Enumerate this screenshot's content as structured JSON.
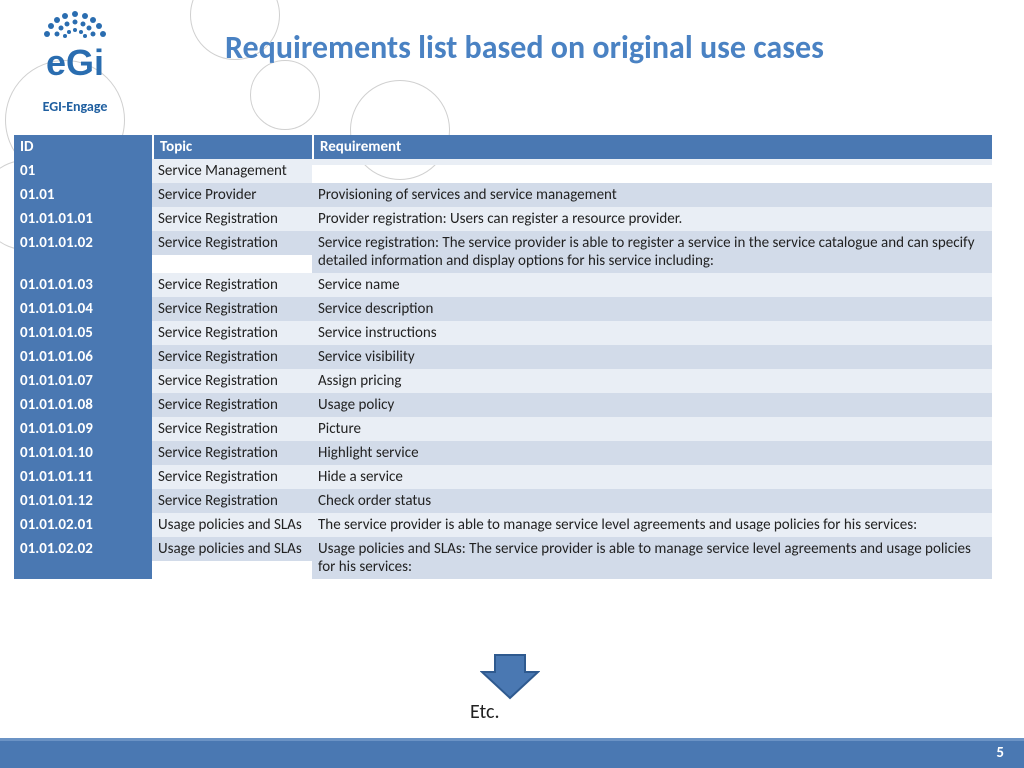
{
  "logo": {
    "text": "eGi",
    "subtitle": "EGI-Engage"
  },
  "title": "Requirements list based on original use cases",
  "colors": {
    "accent": "#4a78b2",
    "title": "#4a82c3"
  },
  "headers": {
    "id": "ID",
    "topic": "Topic",
    "req": "Requirement"
  },
  "rows": [
    {
      "id": "01",
      "topic": "Service Management",
      "req": ""
    },
    {
      "id": "01.01",
      "topic": "Service Provider",
      "req": "Provisioning of services and service management"
    },
    {
      "id": "01.01.01.01",
      "topic": "Service Registration",
      "req": "Provider registration: Users can register a resource provider."
    },
    {
      "id": "01.01.01.02",
      "topic": "Service Registration",
      "req": "Service registration: The service provider is able to register a service in the service catalogue and can specify detailed information and display options for his service including:"
    },
    {
      "id": "01.01.01.03",
      "topic": "Service Registration",
      "req": "Service name"
    },
    {
      "id": "01.01.01.04",
      "topic": "Service Registration",
      "req": "Service description"
    },
    {
      "id": "01.01.01.05",
      "topic": "Service Registration",
      "req": "Service instructions"
    },
    {
      "id": "01.01.01.06",
      "topic": "Service Registration",
      "req": "Service visibility"
    },
    {
      "id": "01.01.01.07",
      "topic": "Service Registration",
      "req": "Assign pricing"
    },
    {
      "id": "01.01.01.08",
      "topic": "Service Registration",
      "req": "Usage policy"
    },
    {
      "id": "01.01.01.09",
      "topic": "Service Registration",
      "req": "Picture"
    },
    {
      "id": "01.01.01.10",
      "topic": "Service Registration",
      "req": "Highlight service"
    },
    {
      "id": "01.01.01.11",
      "topic": "Service Registration",
      "req": "Hide a service"
    },
    {
      "id": "01.01.01.12",
      "topic": "Service Registration",
      "req": "Check order status"
    },
    {
      "id": "01.01.02.01",
      "topic": "Usage policies and SLAs",
      "req": "The service provider is able to manage service level agreements and usage policies for his services:"
    },
    {
      "id": "01.01.02.02",
      "topic": "Usage policies and SLAs",
      "req": "Usage policies and SLAs: The service provider is able to manage service level agreements and usage policies for his services:"
    }
  ],
  "etc": "Etc.",
  "page_number": "5"
}
